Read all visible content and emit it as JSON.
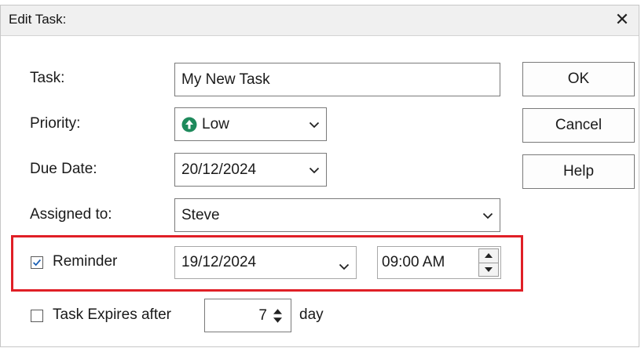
{
  "window": {
    "title": "Edit Task:",
    "close_glyph": "✕"
  },
  "fields": {
    "task": {
      "label": "Task:",
      "value": "My New Task"
    },
    "priority": {
      "label": "Priority:",
      "value": "Low",
      "icon": "up-arrow-circle-icon",
      "icon_color": "#1e8a5c"
    },
    "due_date": {
      "label": "Due Date:",
      "value": "20/12/2024"
    },
    "assigned_to": {
      "label": "Assigned to:",
      "value": "Steve"
    },
    "reminder": {
      "label": "Reminder",
      "checked": true,
      "date": "19/12/2024",
      "time": "09:00 AM"
    },
    "expires": {
      "label": "Task Expires after",
      "checked": false,
      "value": "7",
      "unit": "day"
    }
  },
  "buttons": {
    "ok": "OK",
    "cancel": "Cancel",
    "help": "Help"
  },
  "colors": {
    "highlight": "#e01f26",
    "checkbox_check": "#1a5fb4"
  }
}
